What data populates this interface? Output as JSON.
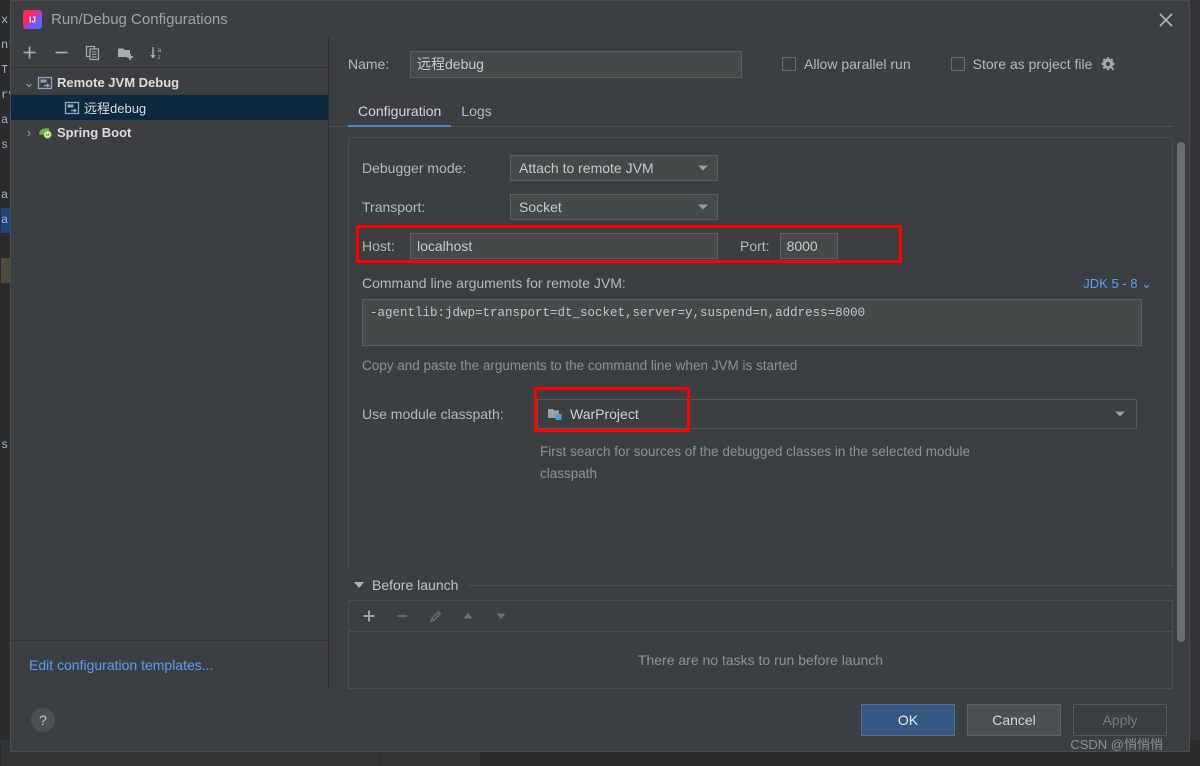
{
  "window": {
    "title": "Run/Debug Configurations",
    "logo_icon": "intellij-idea-logo",
    "close_icon": "close-icon"
  },
  "sidebar": {
    "toolbar": [
      {
        "icon": "plus-icon",
        "name": "add-configuration-button"
      },
      {
        "icon": "minus-icon",
        "name": "remove-configuration-button"
      },
      {
        "icon": "copy-icon",
        "name": "copy-configuration-button"
      },
      {
        "icon": "folder-add-icon",
        "name": "create-folder-button"
      },
      {
        "icon": "sort-alphabetically-icon",
        "name": "sort-configurations-button"
      }
    ],
    "tree": [
      {
        "label": "Remote JVM Debug",
        "icon": "remote-debug-icon",
        "twisty": "⌄",
        "expanded": true,
        "level": 0,
        "selected": false
      },
      {
        "label": "远程debug",
        "icon": "remote-debug-icon",
        "twisty": "",
        "expanded": false,
        "level": 1,
        "selected": true
      },
      {
        "label": "Spring Boot",
        "icon": "spring-boot-icon",
        "twisty": "›",
        "expanded": false,
        "level": 0,
        "selected": false
      }
    ],
    "edit_templates_link": "Edit configuration templates..."
  },
  "name_row": {
    "label": "Name:",
    "value": "远程debug",
    "allow_parallel_run": {
      "label": "Allow parallel run",
      "checked": false
    },
    "store_as_project_file": {
      "label": "Store as project file",
      "checked": false
    },
    "gear_icon": "gear-icon"
  },
  "tabs": [
    {
      "label": "Configuration",
      "active": true
    },
    {
      "label": "Logs",
      "active": false
    }
  ],
  "configuration": {
    "debugger_mode": {
      "label": "Debugger mode:",
      "value": "Attach to remote JVM"
    },
    "transport": {
      "label": "Transport:",
      "value": "Socket"
    },
    "host": {
      "label": "Host:",
      "value": "localhost"
    },
    "port": {
      "label": "Port:",
      "value": "8000"
    },
    "command_line": {
      "label": "Command line arguments for remote JVM:",
      "jdk_selector": "JDK 5 - 8",
      "jdk_chevron": "⌄",
      "value": "-agentlib:jdwp=transport=dt_socket,server=y,suspend=n,address=8000",
      "hint": "Copy and paste the arguments to the command line when JVM is started"
    },
    "module_classpath": {
      "label": "Use module classpath:",
      "value": "WarProject",
      "icon": "module-icon",
      "hint": "First search for sources of the debugged classes in the selected module classpath"
    }
  },
  "before_launch": {
    "title": "Before launch",
    "toolbar": [
      {
        "icon": "plus-icon",
        "name": "add-task-button",
        "enabled": true
      },
      {
        "icon": "minus-icon",
        "name": "remove-task-button",
        "enabled": false
      },
      {
        "icon": "pencil-icon",
        "name": "edit-task-button",
        "enabled": false
      },
      {
        "icon": "arrow-up-icon",
        "name": "move-task-up-button",
        "enabled": false
      },
      {
        "icon": "arrow-down-icon",
        "name": "move-task-down-button",
        "enabled": false
      }
    ],
    "empty_text": "There are no tasks to run before launch"
  },
  "footer": {
    "help_label": "?",
    "ok_label": "OK",
    "cancel_label": "Cancel",
    "apply_label": "Apply"
  },
  "watermark": "CSDN @悄悄悄",
  "backdrop": {
    "editor_fragments": [
      "x",
      "nt",
      "T",
      "rv",
      "ar",
      "s",
      "a",
      "a",
      "s"
    ]
  },
  "colors": {
    "dialog_background": "#3c3f41",
    "field_background": "#45494a",
    "accent_blue": "#4a88c7",
    "link_blue": "#589df6",
    "highlight_red": "#fe0000",
    "selection_blue": "#0d293e",
    "primary_button": "#365880"
  }
}
